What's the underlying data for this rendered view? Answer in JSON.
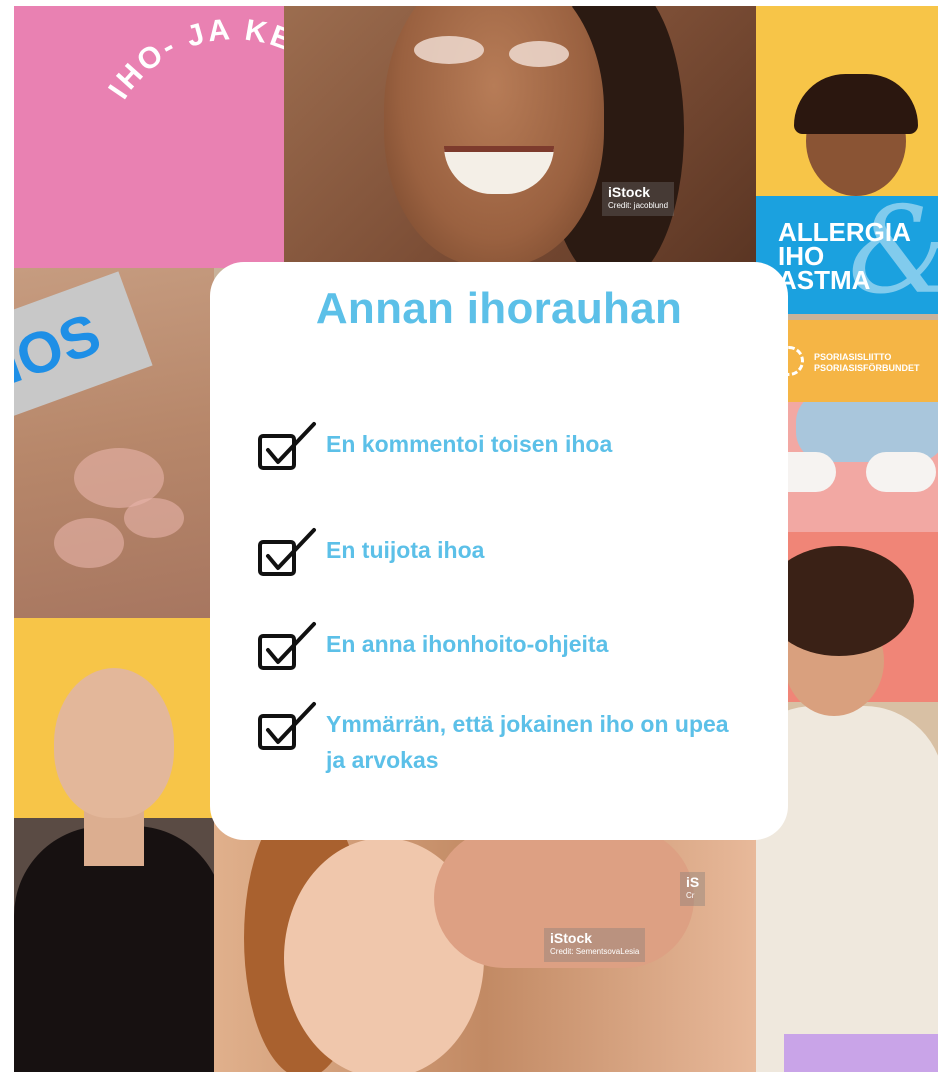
{
  "arc_title": "IHO- JA KEHORAUHA",
  "card": {
    "title": "Annan ihorauhan",
    "items": [
      {
        "text": "En kommentoi toisen ihoa"
      },
      {
        "text": "En tuijota ihoa"
      },
      {
        "text": "En anna ihonhoito-ohjeita"
      },
      {
        "text": "Ymmärrän, että jokainen iho on upea ja arvokas"
      }
    ]
  },
  "logos": {
    "allergia": [
      "ALLERGIA",
      "IHO",
      "ASTMA"
    ],
    "psoriasis": [
      "PSORIASISLIITTO",
      "PSORIASISFÖRBUNDET"
    ]
  },
  "watermarks": {
    "top": {
      "brand": "iStock",
      "credit": "Credit: jacoblund"
    },
    "bottom": {
      "brand": "iStock",
      "credit": "Credit: SementsovaLesia"
    },
    "side": {
      "brand": "iS",
      "credit": "Cr"
    }
  },
  "stamp_text": "IOS",
  "colors": {
    "pink": "#e981b2",
    "yellow": "#f7c548",
    "blue": "#1ba1df",
    "orange": "#f5b545",
    "card_text": "#5cc0e8"
  }
}
